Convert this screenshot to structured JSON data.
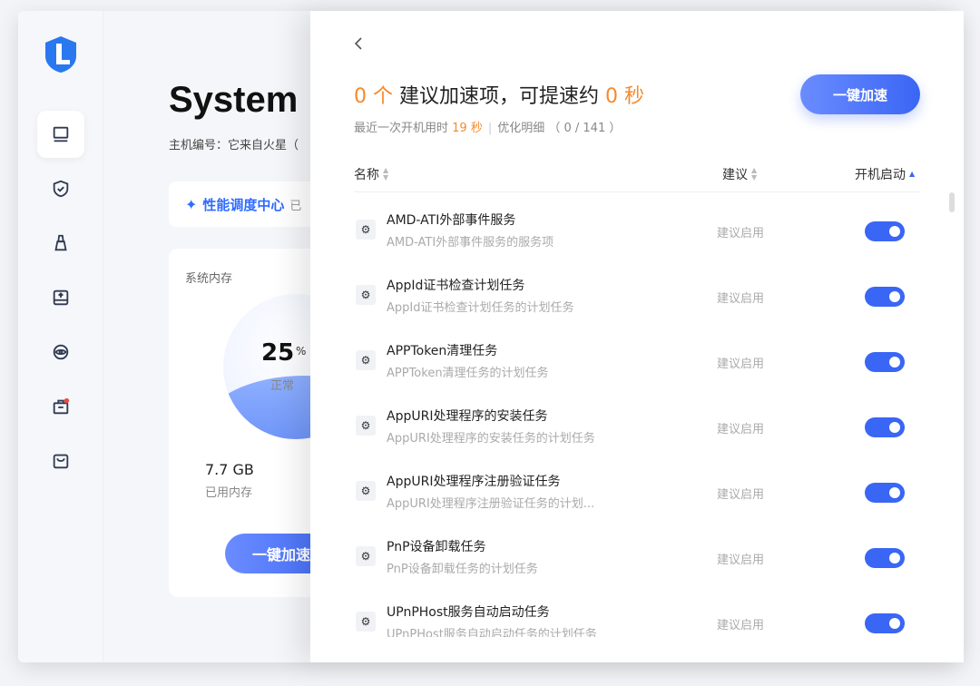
{
  "colors": {
    "accent": "#3a66f5",
    "highlight": "#f58a2b"
  },
  "sidebar": {
    "icons": [
      "computer-icon",
      "shield-icon",
      "broom-icon",
      "drive-icon",
      "eye-icon",
      "toolbox-icon",
      "store-icon"
    ]
  },
  "main": {
    "title": "System",
    "host_label": "主机编号：它来自火星（",
    "perf_label": "性能调度中心",
    "perf_suffix": "已",
    "memory": {
      "title": "系统内存",
      "percent": "25",
      "percent_unit": "%",
      "status": "正常",
      "used_value": "7.7 GB",
      "used_label": "已用内存",
      "button": "一键加速"
    }
  },
  "drawer": {
    "headline": {
      "count": "0 个",
      "middle": " 建议加速项，可提速约 ",
      "seconds": "0 秒"
    },
    "subline": {
      "prefix": "最近一次开机用时 ",
      "boot_seconds": "19 秒",
      "sep": "|",
      "detail": "优化明细 （ 0 / 141 ）"
    },
    "boost_button": "一键加速",
    "columns": {
      "name": "名称",
      "recommendation": "建议",
      "startup": "开机启动"
    },
    "rows": [
      {
        "name": "AMD-ATI外部事件服务",
        "desc": "AMD-ATI外部事件服务的服务项",
        "rec": "建议启用",
        "enabled": true
      },
      {
        "name": "AppId证书检查计划任务",
        "desc": "AppId证书检查计划任务的计划任务",
        "rec": "建议启用",
        "enabled": true
      },
      {
        "name": "APPToken清理任务",
        "desc": "APPToken清理任务的计划任务",
        "rec": "建议启用",
        "enabled": true
      },
      {
        "name": "AppURI处理程序的安装任务",
        "desc": "AppURI处理程序的安装任务的计划任务",
        "rec": "建议启用",
        "enabled": true
      },
      {
        "name": "AppURI处理程序注册验证任务",
        "desc": "AppURI处理程序注册验证任务的计划...",
        "rec": "建议启用",
        "enabled": true
      },
      {
        "name": "PnP设备卸载任务",
        "desc": "PnP设备卸载任务的计划任务",
        "rec": "建议启用",
        "enabled": true
      },
      {
        "name": "UPnPHost服务自动启动任务",
        "desc": "UPnPHost服务自动启动任务的计划任务",
        "rec": "建议启用",
        "enabled": true
      }
    ]
  }
}
